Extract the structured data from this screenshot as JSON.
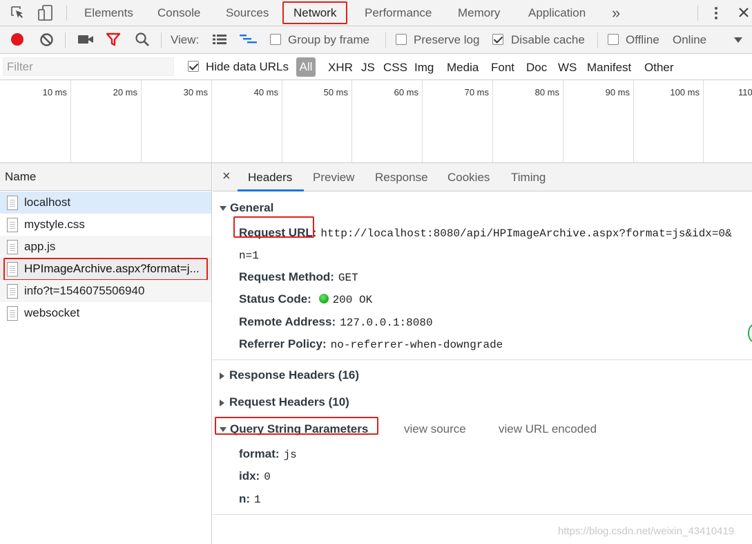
{
  "top_tabs": [
    "Elements",
    "Console",
    "Sources",
    "Network",
    "Performance",
    "Memory",
    "Application"
  ],
  "active_tab": "Network",
  "more_tabs_label": "»",
  "toolbar": {
    "view_label": "View:",
    "group_by_frame": "Group by frame",
    "preserve_log": "Preserve log",
    "disable_cache": "Disable cache",
    "offline": "Offline",
    "online": "Online"
  },
  "filter_bar": {
    "placeholder": "Filter",
    "hide_data_urls": "Hide data URLs",
    "types": [
      "All",
      "XHR",
      "JS",
      "CSS",
      "Img",
      "Media",
      "Font",
      "Doc",
      "WS",
      "Manifest",
      "Other"
    ]
  },
  "timeline_labels": [
    "10 ms",
    "20 ms",
    "30 ms",
    "40 ms",
    "50 ms",
    "60 ms",
    "70 ms",
    "80 ms",
    "90 ms",
    "100 ms",
    "110"
  ],
  "requests_header": "Name",
  "requests": [
    "localhost",
    "mystyle.css",
    "app.js",
    "HPImageArchive.aspx?format=j...",
    "info?t=1546075506940",
    "websocket"
  ],
  "detail": {
    "close": "×",
    "tabs": [
      "Headers",
      "Preview",
      "Response",
      "Cookies",
      "Timing"
    ],
    "general_title": "General",
    "request_url_key": "Request URL:",
    "request_url_value_1": "http://localhost:8080/api/HPImageArchive.aspx?format=js&idx=0&",
    "request_url_value_2": "n=1",
    "request_method_key": "Request Method:",
    "request_method_value": "GET",
    "status_code_key": "Status Code:",
    "status_code_value": "200 OK",
    "remote_address_key": "Remote Address:",
    "remote_address_value": "127.0.0.1:8080",
    "referrer_policy_key": "Referrer Policy:",
    "referrer_policy_value": "no-referrer-when-downgrade",
    "response_headers": "Response Headers (16)",
    "request_headers": "Request Headers (10)",
    "query_title": "Query String Parameters",
    "view_source": "view source",
    "view_url_encoded": "view URL encoded",
    "params": [
      {
        "key": "format:",
        "value": "js"
      },
      {
        "key": "idx:",
        "value": "0"
      },
      {
        "key": "n:",
        "value": "1"
      }
    ]
  },
  "watermark": "https://blog.csdn.net/weixin_43410419",
  "colors": {
    "accent": "#1a73e8",
    "record": "#e3161b",
    "highlight_box": "#e0201b",
    "status_ok": "#1fb823",
    "selected_row": "#dcebfc"
  }
}
